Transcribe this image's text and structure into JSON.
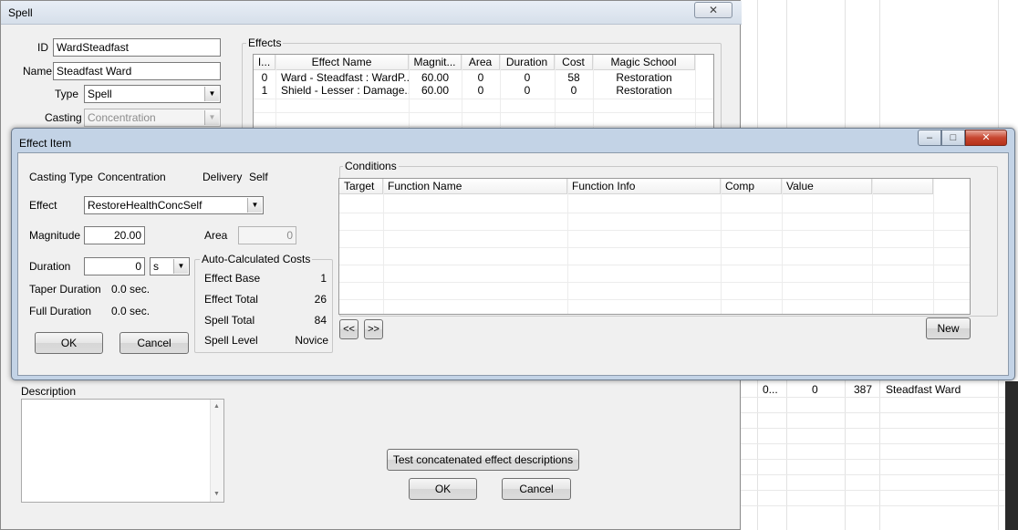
{
  "spell": {
    "title": "Spell",
    "close_glyph": "✕",
    "id_label": "ID",
    "id_value": "WardSteadfast",
    "name_label": "Name",
    "name_value": "Steadfast Ward",
    "type_label": "Type",
    "type_value": "Spell",
    "casting_label": "Casting",
    "casting_value": "Concentration",
    "effects_label": "Effects",
    "effects_columns": [
      "I...",
      "Effect Name",
      "Magnit...",
      "Area",
      "Duration",
      "Cost",
      "Magic School"
    ],
    "effects_rows": [
      {
        "index": "0",
        "name": "Ward - Steadfast : WardP...",
        "magnitude": "60.00",
        "area": "0",
        "duration": "0",
        "cost": "58",
        "school": "Restoration"
      },
      {
        "index": "1",
        "name": "Shield - Lesser : Damage...",
        "magnitude": "60.00",
        "area": "0",
        "duration": "0",
        "cost": "0",
        "school": "Restoration"
      }
    ],
    "description_label": "Description",
    "test_button": "Test concatenated effect descriptions",
    "ok_button": "OK",
    "cancel_button": "Cancel"
  },
  "background_list": {
    "row": {
      "c1": "0...",
      "c2": "0",
      "c3": "387",
      "c4": "Steadfast Ward"
    }
  },
  "effect_item": {
    "title": "Effect Item",
    "minimize_glyph": "–",
    "maximize_glyph": "□",
    "close_glyph": "✕",
    "casting_type_label": "Casting Type",
    "casting_type_value": "Concentration",
    "delivery_label": "Delivery",
    "delivery_value": "Self",
    "effect_label": "Effect",
    "effect_value": "RestoreHealthConcSelf",
    "magnitude_label": "Magnitude",
    "magnitude_value": "20.00",
    "area_label": "Area",
    "area_value": "0",
    "duration_label": "Duration",
    "duration_value": "0",
    "duration_unit": "s",
    "taper_label": "Taper Duration",
    "taper_value": "0.0 sec.",
    "full_label": "Full Duration",
    "full_value": "0.0 sec.",
    "costs_title": "Auto-Calculated Costs",
    "effect_base_label": "Effect Base",
    "effect_base_value": "1",
    "effect_total_label": "Effect Total",
    "effect_total_value": "26",
    "spell_total_label": "Spell Total",
    "spell_total_value": "84",
    "spell_level_label": "Spell Level",
    "spell_level_value": "Novice",
    "ok_button": "OK",
    "cancel_button": "Cancel",
    "conditions_label": "Conditions",
    "conditions_columns": [
      "Target",
      "Function Name",
      "Function Info",
      "Comp",
      "Value",
      ""
    ],
    "prev_button": "<<",
    "next_button": ">>",
    "new_button": "New"
  },
  "icons": {
    "dropdown": "▼"
  }
}
